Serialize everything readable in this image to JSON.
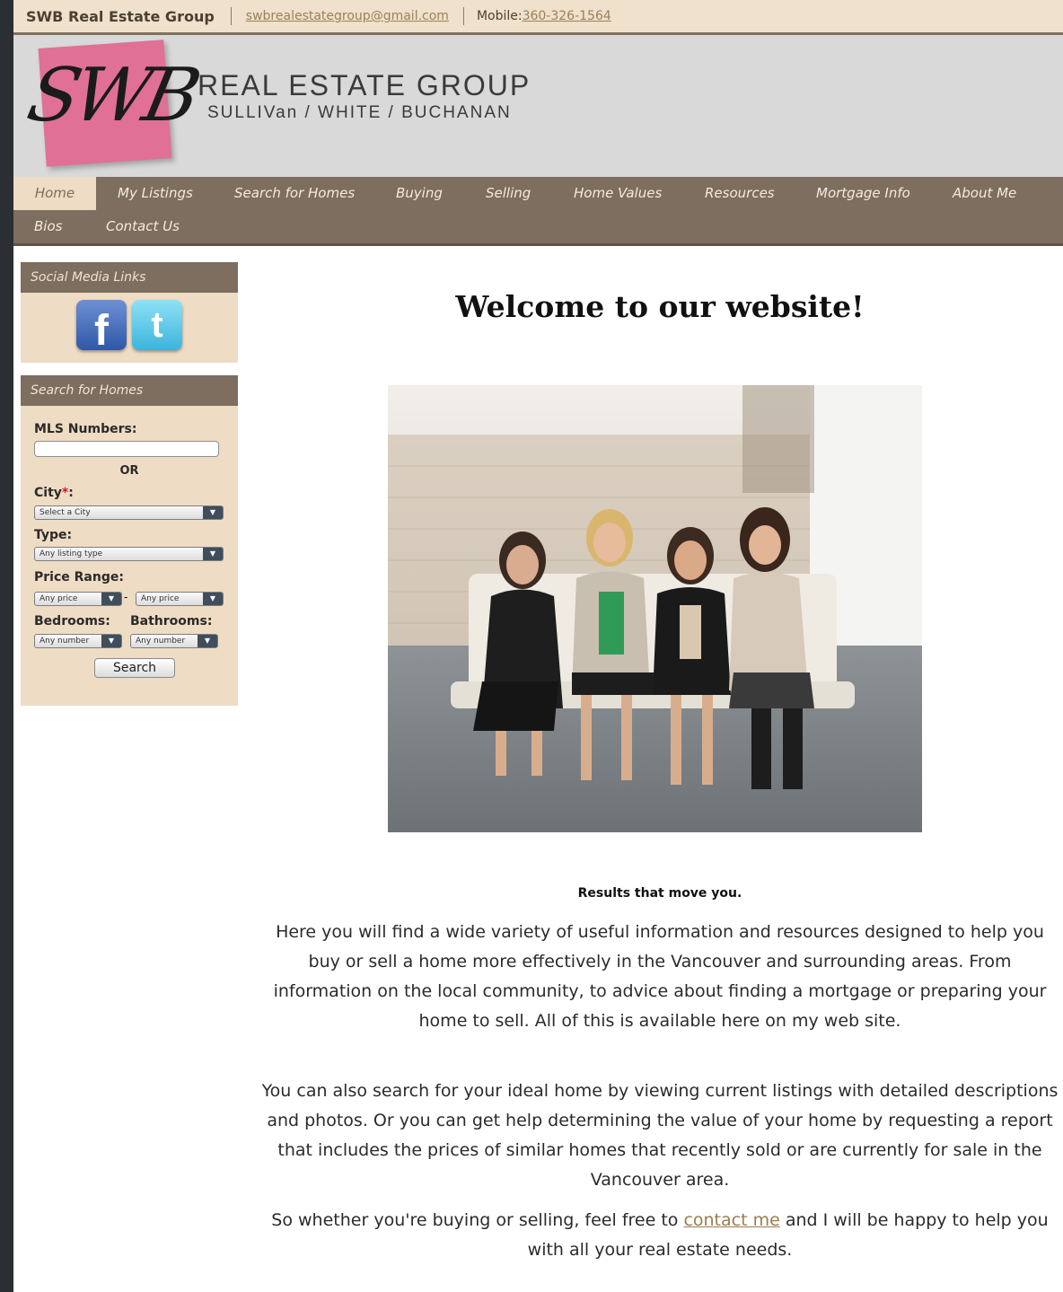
{
  "topbar": {
    "brand": "SWB Real Estate Group",
    "email": "swbrealestategroup@gmail.com",
    "mobile_label": "Mobile:",
    "mobile_number": "360-326-1564"
  },
  "header": {
    "logo_text": "SWB",
    "title": "REAL ESTATE GROUP",
    "subtitle": "SULLIVan / WHITE /  BUCHANAN"
  },
  "nav": {
    "items": [
      {
        "label": "Home",
        "active": true
      },
      {
        "label": "My Listings"
      },
      {
        "label": "Search for Homes"
      },
      {
        "label": "Buying"
      },
      {
        "label": "Selling"
      },
      {
        "label": "Home Values"
      },
      {
        "label": "Resources"
      },
      {
        "label": "Mortgage Info"
      },
      {
        "label": "About Me"
      },
      {
        "label": "Bios"
      },
      {
        "label": "Contact Us"
      }
    ]
  },
  "sidebar": {
    "social": {
      "title": "Social Media Links",
      "icons": [
        "facebook-icon",
        "twitter-icon"
      ]
    },
    "search": {
      "title": "Search for Homes",
      "mls_label": "MLS Numbers:",
      "mls_value": "",
      "or_label": "OR",
      "city_label": "City",
      "city_required": "*",
      "city_colon": ":",
      "city_value": "Select a City",
      "type_label": "Type:",
      "type_value": "Any listing type",
      "price_label": "Price Range:",
      "price_min": "Any price",
      "price_dash": "-",
      "price_max": "Any price",
      "bedrooms_label": "Bedrooms:",
      "bedrooms_value": "Any number",
      "bathrooms_label": "Bathrooms:",
      "bathrooms_value": "Any number",
      "button": "Search"
    }
  },
  "main": {
    "heading": "Welcome to our website!",
    "tagline": "Results that move you.",
    "para1": "Here you will find a wide variety of useful information and resources designed to help you buy or sell a home more effectively in the Vancouver and surrounding areas. From information on the local community, to advice about finding a mortgage or preparing your home to sell.  All of this is available here on my web site.",
    "para2": "You can also search for your ideal home by viewing current listings with detailed descriptions and photos. Or you can get help determining the value of your home by requesting a report that includes the prices of similar homes that recently sold or are currently for sale in the Vancouver area.",
    "para3_before": "So whether you're buying or selling, feel free to ",
    "para3_link": "contact me",
    "para3_after": " and I will be happy to help you with all your real estate needs."
  },
  "colors": {
    "nav_bg": "#7d6e5f",
    "panel_bg": "#efdcc4",
    "logo_pink": "#e07095",
    "link": "#9b7d4e"
  }
}
